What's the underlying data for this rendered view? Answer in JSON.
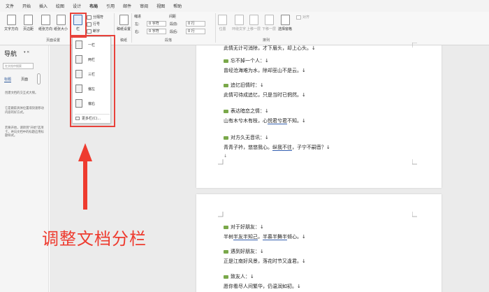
{
  "menu": [
    "文件",
    "开始",
    "插入",
    "绘图",
    "设计",
    "布局",
    "引用",
    "邮件",
    "审阅",
    "视图",
    "帮助"
  ],
  "ribbon": {
    "text_direction": "文字方向",
    "margins": "页边距",
    "orientation": "纸张方向",
    "size": "纸张大小",
    "columns": "栏",
    "breaks": "分隔符",
    "line_numbers": "行号",
    "hyphenation": "断字",
    "page_setup_group": "页面设置",
    "draft": "稿纸设置",
    "draft_group": "稿纸",
    "indent_header": "缩进",
    "spacing_header": "间距",
    "indent_left_label": "左:",
    "indent_left_value": "0 字符",
    "indent_right_label": "右:",
    "indent_right_value": "0 字符",
    "space_before_label": "段前:",
    "space_before_value": "0 行",
    "space_after_label": "段后:",
    "space_after_value": "0 行",
    "paragraph_group": "段落",
    "position": "位置",
    "wrap_text": "环绕文字",
    "bring_forward": "上移一层",
    "send_backward": "下移一层",
    "selection_pane": "选择窗格",
    "align": "对齐",
    "arrange_group": "排列"
  },
  "columns_menu": {
    "items": [
      "一栏",
      "两栏",
      "三栏",
      "偏左",
      "偏右"
    ],
    "more": "更多栏(C)..."
  },
  "nav": {
    "title": "导航",
    "search_placeholder": "在文档中搜索",
    "tab_headings": "标题",
    "tab_pages": "页面",
    "desc1": "创建文档的交互式大纲。",
    "desc2": "它是跟踪具体位置或快速移动内容的好方式。",
    "desc3": "若要开始，请转到\"开始\"选项卡，并向文档中的标题应用标题样式。"
  },
  "document": {
    "page1": {
      "top_line": "此情无计可消除，才下眉头，却上心头。↓",
      "items": [
        {
          "heading": "忘不掉一个人：↓",
          "text_pre": "曾经沧海难为水，除却巫山不是云。↓",
          "text_u": "",
          "text_post": ""
        },
        {
          "heading": "追忆旧情时：↓",
          "text_pre": "此情可待成追忆，只是当时已惘然。↓",
          "text_u": "",
          "text_post": ""
        },
        {
          "heading": "表达暗恋之情：↓",
          "text_pre": "山有木兮木有枝，心",
          "text_u": "悦君兮君",
          "text_post": "不知。↓"
        },
        {
          "heading": "对方久无音讯：↓",
          "text_pre": "青青子衿，悠悠我心。",
          "text_u": "纵我不往",
          "text_post": "，子宁不嗣音？↓"
        }
      ]
    },
    "page2": {
      "items": [
        {
          "heading": "对于好朋友：↓",
          "text_pre": "半树",
          "text_u": "半友半知己",
          "text_mid": "，",
          "text_u2": "半慕半舞半",
          "text_post": "倾心。↓"
        },
        {
          "heading": "遇到好朋友：↓",
          "text_pre": "正是江南好风景，落花时节又逢君。↓",
          "text_u": "",
          "text_mid": "",
          "text_u2": "",
          "text_post": ""
        },
        {
          "heading": "致友人：↓",
          "text_pre": "愿你看尽人间繁华，仍温润如初。↓",
          "text_u": "",
          "text_mid": "",
          "text_u2": "",
          "text_post": ""
        }
      ]
    }
  },
  "annotation": {
    "caption": "调整文档分栏",
    "color": "#ee3b2f"
  }
}
